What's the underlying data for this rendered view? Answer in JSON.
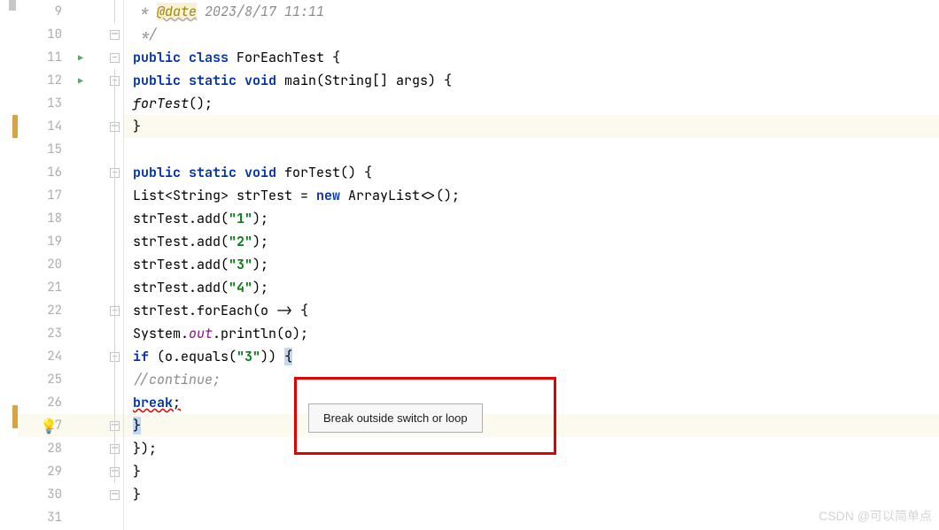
{
  "gutter": {
    "lines": [
      9,
      10,
      11,
      12,
      13,
      14,
      15,
      16,
      17,
      18,
      19,
      20,
      21,
      22,
      23,
      24,
      25,
      26,
      27,
      28,
      29,
      30,
      31
    ]
  },
  "code": {
    "l9_ann": "@date",
    "l9_rest": " 2023/8/17 11:11",
    "l9_prefix": " * ",
    "l10": " */",
    "l11_public": "public ",
    "l11_class": "class ",
    "l11_name": "ForEachTest {",
    "l12_public": "public ",
    "l12_static": "static ",
    "l12_void": "void ",
    "l12_sig": "main(String[] args) {",
    "l13_call": "forTest",
    "l13_rest": "();",
    "l14": "}",
    "l16_public": "public ",
    "l16_static": "static ",
    "l16_void": "void ",
    "l16_sig": "forTest() {",
    "l17_a": "List<String> strTest = ",
    "l17_new": "new ",
    "l17_b": "ArrayList<>();",
    "l18_a": "strTest.add(",
    "l18_s": "\"1\"",
    "l18_b": ");",
    "l19_a": "strTest.add(",
    "l19_s": "\"2\"",
    "l19_b": ");",
    "l20_a": "strTest.add(",
    "l20_s": "\"3\"",
    "l20_b": ");",
    "l21_a": "strTest.add(",
    "l21_s": "\"4\"",
    "l21_b": ");",
    "l22": "strTest.forEach(o -> {",
    "l23_a": "System.",
    "l23_out": "out",
    "l23_b": ".println(o);",
    "l24_if": "if ",
    "l24_a": "(o.equals(",
    "l24_s": "\"3\"",
    "l24_b": ")) ",
    "l24_brace": "{",
    "l25": "//continue;",
    "l26_break": "break",
    "l26_semi": ";",
    "l27": "}",
    "l28": "});",
    "l29": "}",
    "l30": "}"
  },
  "tooltip": {
    "text": "Break outside switch or loop"
  },
  "watermark": "CSDN @可以简单点"
}
